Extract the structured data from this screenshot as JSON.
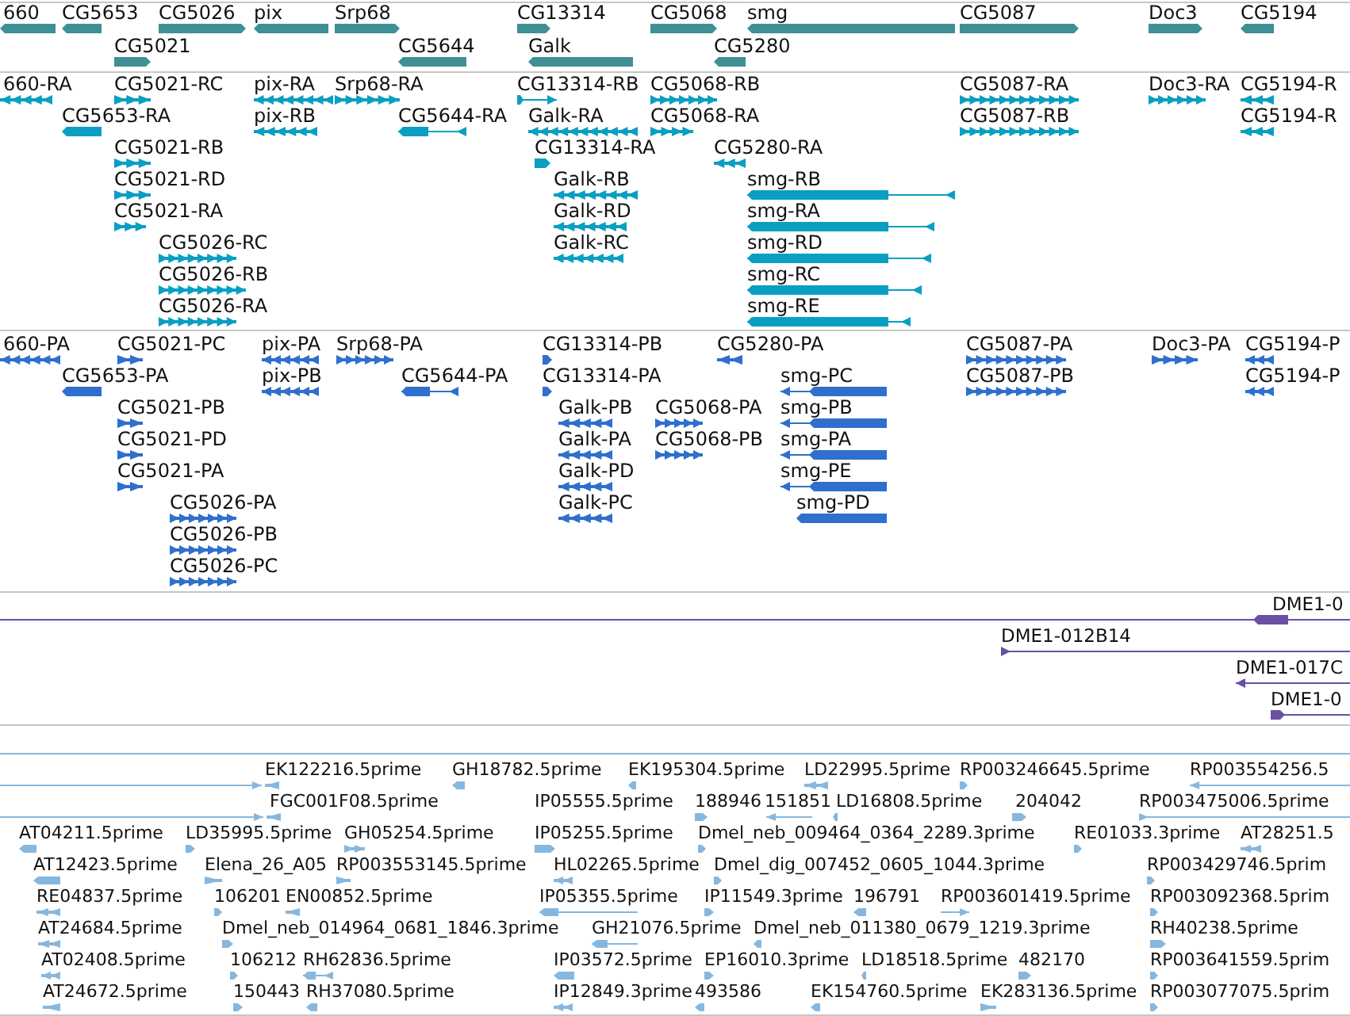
{
  "tracks": [
    {
      "kind": "gene",
      "features": [
        {
          "label": "660",
          "reverse": true
        },
        {
          "label": "CG5653",
          "reverse": true
        },
        {
          "label": "CG5026",
          "reverse": false
        },
        {
          "label": "pix",
          "reverse": true
        },
        {
          "label": "Srp68",
          "reverse": false
        },
        {
          "label": "CG13314",
          "reverse": false
        },
        {
          "label": "CG5068",
          "reverse": false
        },
        {
          "label": "smg",
          "reverse": true
        },
        {
          "label": "CG5087",
          "reverse": false
        },
        {
          "label": "Doc3",
          "reverse": false
        },
        {
          "label": "CG5194",
          "reverse": true
        },
        {
          "label": "CG5021",
          "reverse": false
        },
        {
          "label": "CG5644",
          "reverse": true
        },
        {
          "label": "Galk",
          "reverse": true
        },
        {
          "label": "CG5280",
          "reverse": true
        }
      ]
    },
    {
      "kind": "transcript",
      "features": [
        {
          "label": "660-RA",
          "reverse": true
        },
        {
          "label": "CG5021-RC",
          "reverse": false
        },
        {
          "label": "pix-RA",
          "reverse": true
        },
        {
          "label": "Srp68-RA",
          "reverse": false
        },
        {
          "label": "CG13314-RB",
          "reverse": false
        },
        {
          "label": "CG5068-RB",
          "reverse": false
        },
        {
          "label": "CG5087-RA",
          "reverse": false
        },
        {
          "label": "Doc3-RA",
          "reverse": false
        },
        {
          "label": "CG5194-R",
          "reverse": true
        },
        {
          "label": "CG5653-RA",
          "reverse": true
        },
        {
          "label": "pix-RB",
          "reverse": true
        },
        {
          "label": "CG5644-RA",
          "reverse": true
        },
        {
          "label": "Galk-RA",
          "reverse": true
        },
        {
          "label": "CG5068-RA",
          "reverse": false
        },
        {
          "label": "CG5087-RB",
          "reverse": false
        },
        {
          "label": "CG5194-R",
          "reverse": true
        },
        {
          "label": "CG5021-RB",
          "reverse": false
        },
        {
          "label": "CG13314-RA",
          "reverse": false
        },
        {
          "label": "CG5280-RA",
          "reverse": true
        },
        {
          "label": "CG5021-RD",
          "reverse": false
        },
        {
          "label": "Galk-RB",
          "reverse": true
        },
        {
          "label": "smg-RB",
          "reverse": true
        },
        {
          "label": "CG5021-RA",
          "reverse": false
        },
        {
          "label": "Galk-RD",
          "reverse": true
        },
        {
          "label": "smg-RA",
          "reverse": true
        },
        {
          "label": "CG5026-RC",
          "reverse": false
        },
        {
          "label": "Galk-RC",
          "reverse": true
        },
        {
          "label": "smg-RD",
          "reverse": true
        },
        {
          "label": "CG5026-RB",
          "reverse": false
        },
        {
          "label": "smg-RC",
          "reverse": true
        },
        {
          "label": "CG5026-RA",
          "reverse": false
        },
        {
          "label": "smg-RE",
          "reverse": true
        }
      ]
    },
    {
      "kind": "protein",
      "features": [
        {
          "label": "660-PA",
          "reverse": true
        },
        {
          "label": "CG5021-PC",
          "reverse": false
        },
        {
          "label": "pix-PA",
          "reverse": true
        },
        {
          "label": "Srp68-PA",
          "reverse": false
        },
        {
          "label": "CG13314-PB",
          "reverse": false
        },
        {
          "label": "CG5280-PA",
          "reverse": true
        },
        {
          "label": "CG5087-PA",
          "reverse": false
        },
        {
          "label": "Doc3-PA",
          "reverse": false
        },
        {
          "label": "CG5194-P",
          "reverse": true
        },
        {
          "label": "CG5653-PA",
          "reverse": true
        },
        {
          "label": "pix-PB",
          "reverse": true
        },
        {
          "label": "CG5644-PA",
          "reverse": true
        },
        {
          "label": "CG13314-PA",
          "reverse": false
        },
        {
          "label": "smg-PC",
          "reverse": true
        },
        {
          "label": "CG5087-PB",
          "reverse": false
        },
        {
          "label": "CG5194-P",
          "reverse": true
        },
        {
          "label": "CG5021-PB",
          "reverse": false
        },
        {
          "label": "Galk-PB",
          "reverse": true
        },
        {
          "label": "CG5068-PA",
          "reverse": false
        },
        {
          "label": "smg-PB",
          "reverse": true
        },
        {
          "label": "CG5021-PD",
          "reverse": false
        },
        {
          "label": "Galk-PA",
          "reverse": true
        },
        {
          "label": "CG5068-PB",
          "reverse": false
        },
        {
          "label": "smg-PA",
          "reverse": true
        },
        {
          "label": "CG5021-PA",
          "reverse": false
        },
        {
          "label": "Galk-PD",
          "reverse": true
        },
        {
          "label": "smg-PE",
          "reverse": true
        },
        {
          "label": "CG5026-PA",
          "reverse": false
        },
        {
          "label": "Galk-PC",
          "reverse": true
        },
        {
          "label": "smg-PD",
          "reverse": true
        },
        {
          "label": "CG5026-PB",
          "reverse": false
        },
        {
          "label": "CG5026-PC",
          "reverse": false
        }
      ]
    },
    {
      "kind": "clone",
      "features": [
        {
          "label": "DME1-0",
          "reverse": true
        },
        {
          "label": "DME1-012B14",
          "reverse": false
        },
        {
          "label": "DME1-017C",
          "reverse": true
        },
        {
          "label": "DME1-0",
          "reverse": false
        }
      ]
    },
    {
      "kind": "est",
      "features": [
        {
          "reverse": false
        },
        {
          "label": "EK122216.5prime",
          "reverse": true
        },
        {
          "label": "GH18782.5prime",
          "reverse": true
        },
        {
          "label": "EK195304.5prime",
          "reverse": true
        },
        {
          "label": "LD22995.5prime",
          "reverse": true
        },
        {
          "label": "RP003246645.5prime",
          "reverse": false
        },
        {
          "label": "RP003554256.5",
          "reverse": true
        },
        {
          "reverse": false
        },
        {
          "label": "FGC001F08.5prime",
          "reverse": true
        },
        {
          "label": "IP05555.5prime"
        },
        {
          "label": "188946",
          "reverse": false
        },
        {
          "label": "151851",
          "reverse": true
        },
        {
          "label": "LD16808.5prime",
          "reverse": true
        },
        {
          "label": "204042",
          "reverse": false
        },
        {
          "label": "RP003475006.5prime",
          "reverse": false
        },
        {
          "label": "AT04211.5prime",
          "reverse": true
        },
        {
          "label": "LD35995.5prime",
          "reverse": false
        },
        {
          "label": "GH05254.5prime",
          "reverse": false
        },
        {
          "label": "IP05255.5prime",
          "reverse": false
        },
        {
          "label": "Dmel_neb_009464_0364_2289.3prime",
          "reverse": false
        },
        {
          "label": "RE01033.3prime",
          "reverse": false
        },
        {
          "label": "AT28251.5",
          "reverse": true
        },
        {
          "label": "AT12423.5prime",
          "reverse": true
        },
        {
          "label": "Elena_26_A05",
          "reverse": false
        },
        {
          "label": "RP003553145.5prime",
          "reverse": false
        },
        {
          "label": "HL02265.5prime",
          "reverse": true
        },
        {
          "label": "Dmel_dig_007452_0605_1044.3prime",
          "reverse": false
        },
        {
          "label": "RP003429746.5prim",
          "reverse": false
        },
        {
          "label": "RE04837.5prime",
          "reverse": true
        },
        {
          "label": "106201",
          "reverse": false
        },
        {
          "label": "EN00852.5prime",
          "reverse": true
        },
        {
          "label": "IP05355.5prime",
          "reverse": true
        },
        {
          "label": "IP11549.3prime",
          "reverse": false
        },
        {
          "label": "196791",
          "reverse": true
        },
        {
          "label": "RP003601419.5prime",
          "reverse": false
        },
        {
          "label": "RP003092368.5prim",
          "reverse": false
        },
        {
          "label": "AT24684.5prime",
          "reverse": true
        },
        {
          "label": "Dmel_neb_014964_0681_1846.3prime",
          "reverse": false
        },
        {
          "label": "GH21076.5prime",
          "reverse": true
        },
        {
          "label": "Dmel_neb_011380_0679_1219.3prime",
          "reverse": true
        },
        {
          "label": "RH40238.5prime",
          "reverse": false
        },
        {
          "label": "AT02408.5prime",
          "reverse": true
        },
        {
          "label": "106212",
          "reverse": false
        },
        {
          "label": "RH62836.5prime",
          "reverse": true
        },
        {
          "label": "IP03572.5prime",
          "reverse": true
        },
        {
          "label": "EP16010.3prime",
          "reverse": false
        },
        {
          "label": "LD18518.5prime",
          "reverse": true
        },
        {
          "label": "482170",
          "reverse": false
        },
        {
          "label": "RP003641559.5prim",
          "reverse": false
        },
        {
          "label": "AT24672.5prime",
          "reverse": true
        },
        {
          "label": "150443",
          "reverse": false
        },
        {
          "label": "RH37080.5prime",
          "reverse": true
        },
        {
          "label": "IP12849.3prime",
          "reverse": true
        },
        {
          "label": "493586",
          "reverse": true
        },
        {
          "label": "EK154760.5prime",
          "reverse": true
        },
        {
          "label": "EK283136.5prime",
          "reverse": false
        },
        {
          "label": "RP003077075.5prim",
          "reverse": false
        }
      ]
    }
  ]
}
